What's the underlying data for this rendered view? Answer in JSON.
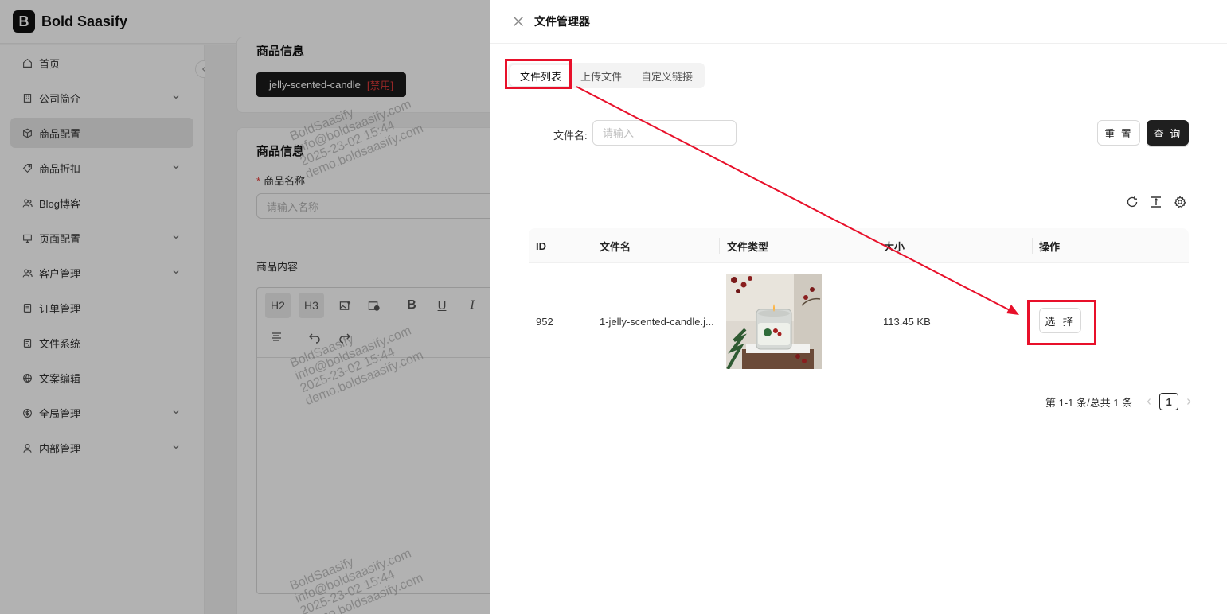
{
  "app": {
    "logo_letter": "B",
    "name": "Bold Saasify"
  },
  "sidebar": {
    "items": [
      {
        "label": "首页",
        "icon": "home-icon",
        "has_children": false,
        "active": false
      },
      {
        "label": "公司简介",
        "icon": "building-icon",
        "has_children": true,
        "active": false
      },
      {
        "label": "商品配置",
        "icon": "box-icon",
        "has_children": false,
        "active": true
      },
      {
        "label": "商品折扣",
        "icon": "tag-icon",
        "has_children": true,
        "active": false
      },
      {
        "label": "Blog博客",
        "icon": "users-icon",
        "has_children": false,
        "active": false
      },
      {
        "label": "页面配置",
        "icon": "monitor-icon",
        "has_children": true,
        "active": false
      },
      {
        "label": "客户管理",
        "icon": "users-icon",
        "has_children": true,
        "active": false
      },
      {
        "label": "订单管理",
        "icon": "file-icon",
        "has_children": false,
        "active": false
      },
      {
        "label": "文件系统",
        "icon": "folder-icon",
        "has_children": false,
        "active": false
      },
      {
        "label": "文案编辑",
        "icon": "globe-icon",
        "has_children": false,
        "active": false
      },
      {
        "label": "全局管理",
        "icon": "dollar-icon",
        "has_children": true,
        "active": false
      },
      {
        "label": "内部管理",
        "icon": "user-icon",
        "has_children": true,
        "active": false
      }
    ]
  },
  "background_form": {
    "card1_title": "商品信息",
    "product_tag": "jelly-scented-candle",
    "product_tag_status": "[禁用]",
    "card2_title": "商品信息",
    "name_label": "商品名称",
    "name_required": "*",
    "name_placeholder": "请输入名称",
    "content_label": "商品内容",
    "toolbar": {
      "h2": "H2",
      "h3": "H3",
      "bold": "B",
      "underline": "U",
      "italic": "I"
    }
  },
  "watermark": {
    "line1": "BoldSaasify",
    "line2": "info@boldsaasify.com",
    "line3": "2025-23-02 15:44",
    "line4": "demo.boldsaasify.com"
  },
  "drawer": {
    "title": "文件管理器",
    "tabs": [
      {
        "label": "文件列表",
        "active": true
      },
      {
        "label": "上传文件",
        "active": false
      },
      {
        "label": "自定义链接",
        "active": false
      }
    ],
    "search": {
      "label": "文件名",
      "label_colon": ":",
      "placeholder": "请输入",
      "value": "",
      "reset_label": "重 置",
      "query_label": "查 询"
    },
    "table": {
      "columns": [
        "ID",
        "文件名",
        "文件类型",
        "大小",
        "操作"
      ],
      "rows": [
        {
          "id": "952",
          "filename": "1-jelly-scented-candle.j...",
          "thumbnail": "candle-image",
          "size": "113.45 KB",
          "action": "选 择"
        }
      ]
    },
    "pagination": {
      "summary": "第 1-1 条/总共 1 条",
      "current_page": "1"
    }
  },
  "colors": {
    "annotation_red": "#e8102a",
    "primary_dark": "#1f1f1f",
    "disabled_red": "#e63b3b"
  }
}
